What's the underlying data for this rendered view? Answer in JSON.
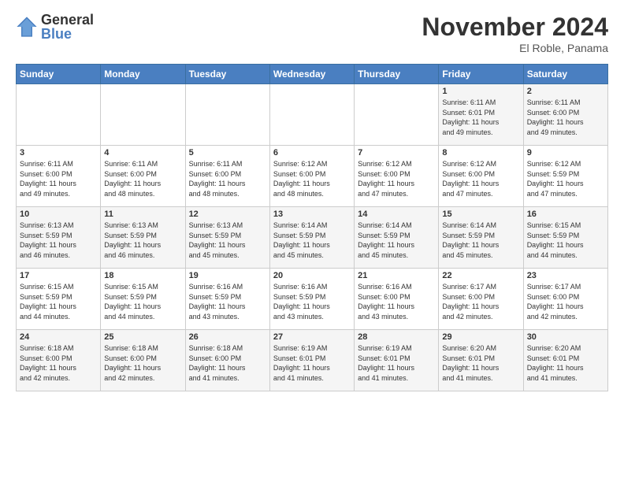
{
  "header": {
    "logo_general": "General",
    "logo_blue": "Blue",
    "month_title": "November 2024",
    "location": "El Roble, Panama"
  },
  "days_of_week": [
    "Sunday",
    "Monday",
    "Tuesday",
    "Wednesday",
    "Thursday",
    "Friday",
    "Saturday"
  ],
  "weeks": [
    [
      {
        "day": "",
        "info": ""
      },
      {
        "day": "",
        "info": ""
      },
      {
        "day": "",
        "info": ""
      },
      {
        "day": "",
        "info": ""
      },
      {
        "day": "",
        "info": ""
      },
      {
        "day": "1",
        "info": "Sunrise: 6:11 AM\nSunset: 6:01 PM\nDaylight: 11 hours\nand 49 minutes."
      },
      {
        "day": "2",
        "info": "Sunrise: 6:11 AM\nSunset: 6:00 PM\nDaylight: 11 hours\nand 49 minutes."
      }
    ],
    [
      {
        "day": "3",
        "info": "Sunrise: 6:11 AM\nSunset: 6:00 PM\nDaylight: 11 hours\nand 49 minutes."
      },
      {
        "day": "4",
        "info": "Sunrise: 6:11 AM\nSunset: 6:00 PM\nDaylight: 11 hours\nand 48 minutes."
      },
      {
        "day": "5",
        "info": "Sunrise: 6:11 AM\nSunset: 6:00 PM\nDaylight: 11 hours\nand 48 minutes."
      },
      {
        "day": "6",
        "info": "Sunrise: 6:12 AM\nSunset: 6:00 PM\nDaylight: 11 hours\nand 48 minutes."
      },
      {
        "day": "7",
        "info": "Sunrise: 6:12 AM\nSunset: 6:00 PM\nDaylight: 11 hours\nand 47 minutes."
      },
      {
        "day": "8",
        "info": "Sunrise: 6:12 AM\nSunset: 6:00 PM\nDaylight: 11 hours\nand 47 minutes."
      },
      {
        "day": "9",
        "info": "Sunrise: 6:12 AM\nSunset: 5:59 PM\nDaylight: 11 hours\nand 47 minutes."
      }
    ],
    [
      {
        "day": "10",
        "info": "Sunrise: 6:13 AM\nSunset: 5:59 PM\nDaylight: 11 hours\nand 46 minutes."
      },
      {
        "day": "11",
        "info": "Sunrise: 6:13 AM\nSunset: 5:59 PM\nDaylight: 11 hours\nand 46 minutes."
      },
      {
        "day": "12",
        "info": "Sunrise: 6:13 AM\nSunset: 5:59 PM\nDaylight: 11 hours\nand 45 minutes."
      },
      {
        "day": "13",
        "info": "Sunrise: 6:14 AM\nSunset: 5:59 PM\nDaylight: 11 hours\nand 45 minutes."
      },
      {
        "day": "14",
        "info": "Sunrise: 6:14 AM\nSunset: 5:59 PM\nDaylight: 11 hours\nand 45 minutes."
      },
      {
        "day": "15",
        "info": "Sunrise: 6:14 AM\nSunset: 5:59 PM\nDaylight: 11 hours\nand 45 minutes."
      },
      {
        "day": "16",
        "info": "Sunrise: 6:15 AM\nSunset: 5:59 PM\nDaylight: 11 hours\nand 44 minutes."
      }
    ],
    [
      {
        "day": "17",
        "info": "Sunrise: 6:15 AM\nSunset: 5:59 PM\nDaylight: 11 hours\nand 44 minutes."
      },
      {
        "day": "18",
        "info": "Sunrise: 6:15 AM\nSunset: 5:59 PM\nDaylight: 11 hours\nand 44 minutes."
      },
      {
        "day": "19",
        "info": "Sunrise: 6:16 AM\nSunset: 5:59 PM\nDaylight: 11 hours\nand 43 minutes."
      },
      {
        "day": "20",
        "info": "Sunrise: 6:16 AM\nSunset: 5:59 PM\nDaylight: 11 hours\nand 43 minutes."
      },
      {
        "day": "21",
        "info": "Sunrise: 6:16 AM\nSunset: 6:00 PM\nDaylight: 11 hours\nand 43 minutes."
      },
      {
        "day": "22",
        "info": "Sunrise: 6:17 AM\nSunset: 6:00 PM\nDaylight: 11 hours\nand 42 minutes."
      },
      {
        "day": "23",
        "info": "Sunrise: 6:17 AM\nSunset: 6:00 PM\nDaylight: 11 hours\nand 42 minutes."
      }
    ],
    [
      {
        "day": "24",
        "info": "Sunrise: 6:18 AM\nSunset: 6:00 PM\nDaylight: 11 hours\nand 42 minutes."
      },
      {
        "day": "25",
        "info": "Sunrise: 6:18 AM\nSunset: 6:00 PM\nDaylight: 11 hours\nand 42 minutes."
      },
      {
        "day": "26",
        "info": "Sunrise: 6:18 AM\nSunset: 6:00 PM\nDaylight: 11 hours\nand 41 minutes."
      },
      {
        "day": "27",
        "info": "Sunrise: 6:19 AM\nSunset: 6:01 PM\nDaylight: 11 hours\nand 41 minutes."
      },
      {
        "day": "28",
        "info": "Sunrise: 6:19 AM\nSunset: 6:01 PM\nDaylight: 11 hours\nand 41 minutes."
      },
      {
        "day": "29",
        "info": "Sunrise: 6:20 AM\nSunset: 6:01 PM\nDaylight: 11 hours\nand 41 minutes."
      },
      {
        "day": "30",
        "info": "Sunrise: 6:20 AM\nSunset: 6:01 PM\nDaylight: 11 hours\nand 41 minutes."
      }
    ]
  ]
}
